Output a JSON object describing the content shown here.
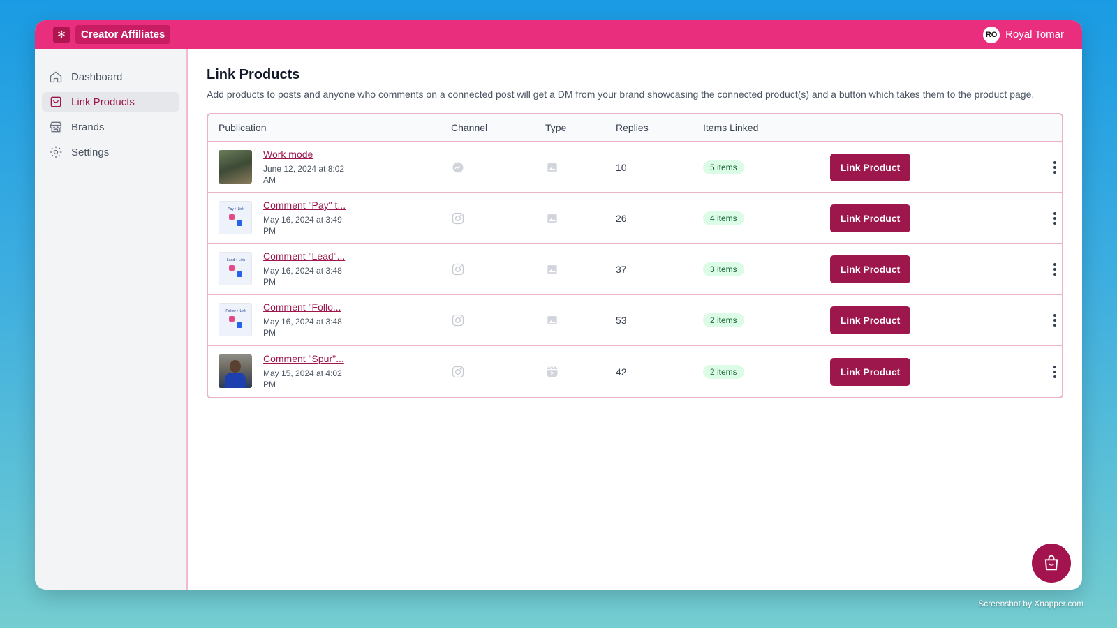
{
  "app": {
    "name": "Creator Affiliates",
    "logo_icon": "flower-logo-icon",
    "user": {
      "initials": "RO",
      "name": "Royal Tomar"
    }
  },
  "sidebar": {
    "items": [
      {
        "label": "Dashboard",
        "icon": "home-icon",
        "active": false
      },
      {
        "label": "Link Products",
        "icon": "shopping-bag-icon",
        "active": true
      },
      {
        "label": "Brands",
        "icon": "store-icon",
        "active": false
      },
      {
        "label": "Settings",
        "icon": "gear-icon",
        "active": false
      }
    ]
  },
  "page": {
    "title": "Link Products",
    "description": "Add products to posts and anyone who comments on a connected post will get a DM from your brand showcasing the connected product(s) and a button which takes them to the product page."
  },
  "table": {
    "headers": [
      "Publication",
      "Channel",
      "Type",
      "Replies",
      "Items Linked"
    ],
    "rows": [
      {
        "title": "Work mode",
        "date": "June 12, 2024 at 8:02 AM",
        "channel": "messenger-icon",
        "type": "image-icon",
        "replies": "10",
        "items": "5 items",
        "button": "Link Product"
      },
      {
        "title": "Comment \"Pay\" t...",
        "date": "May 16, 2024 at 3:49 PM",
        "channel": "instagram-icon",
        "type": "image-icon",
        "replies": "26",
        "items": "4 items",
        "button": "Link Product"
      },
      {
        "title": "Comment \"Lead\"...",
        "date": "May 16, 2024 at 3:48 PM",
        "channel": "instagram-icon",
        "type": "image-icon",
        "replies": "37",
        "items": "3 items",
        "button": "Link Product"
      },
      {
        "title": "Comment \"Follo...",
        "date": "May 16, 2024 at 3:48 PM",
        "channel": "instagram-icon",
        "type": "image-icon",
        "replies": "53",
        "items": "2 items",
        "button": "Link Product"
      },
      {
        "title": "Comment \"Spur\"...",
        "date": "May 15, 2024 at 4:02 PM",
        "channel": "instagram-icon",
        "type": "video-icon",
        "replies": "42",
        "items": "2 items",
        "button": "Link Product"
      }
    ]
  },
  "credit": "Screenshot by Xnapper.com",
  "colors": {
    "topbar": "#ea2e7e",
    "accent": "#9d174d",
    "badge_bg": "#dcfce7",
    "badge_text": "#166534"
  }
}
